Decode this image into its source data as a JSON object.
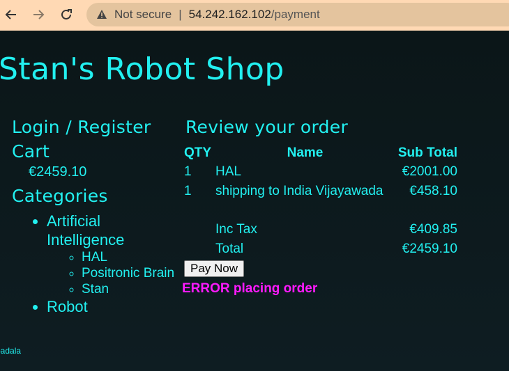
{
  "browser": {
    "security_label": "Not secure",
    "separator": "|",
    "host": "54.242.162.102",
    "path": "/payment"
  },
  "shop": {
    "title": "Stan's Robot Shop"
  },
  "sidebar": {
    "login_label": "Login / Register",
    "cart_heading": "Cart",
    "cart_total": "€2459.10",
    "categories_heading": "Categories",
    "categories": [
      {
        "label": "Artificial Intelligence",
        "items": [
          "HAL",
          "Positronic Brain",
          "Stan"
        ]
      },
      {
        "label": "Robot"
      }
    ]
  },
  "order": {
    "heading": "Review your order",
    "columns": [
      "QTY",
      "Name",
      "Sub Total"
    ],
    "rows": [
      {
        "qty": "1",
        "name": "HAL",
        "subtotal": "€2001.00"
      },
      {
        "qty": "1",
        "name": "shipping to India Vijayawada",
        "subtotal": "€458.10"
      }
    ],
    "tax_label": "Inc Tax",
    "tax_value": "€409.85",
    "total_label": "Total",
    "total_value": "€2459.10",
    "pay_button": "Pay Now",
    "error_message": "ERROR placing order"
  },
  "footer": {
    "text": "padala"
  },
  "colors": {
    "accent": "#22f0f0",
    "error": "#ff1aff",
    "background": "#0b1618",
    "browser_bar": "#ffd9b4"
  },
  "icons": [
    "back-arrow-icon",
    "forward-arrow-icon",
    "reload-icon",
    "warning-icon"
  ]
}
